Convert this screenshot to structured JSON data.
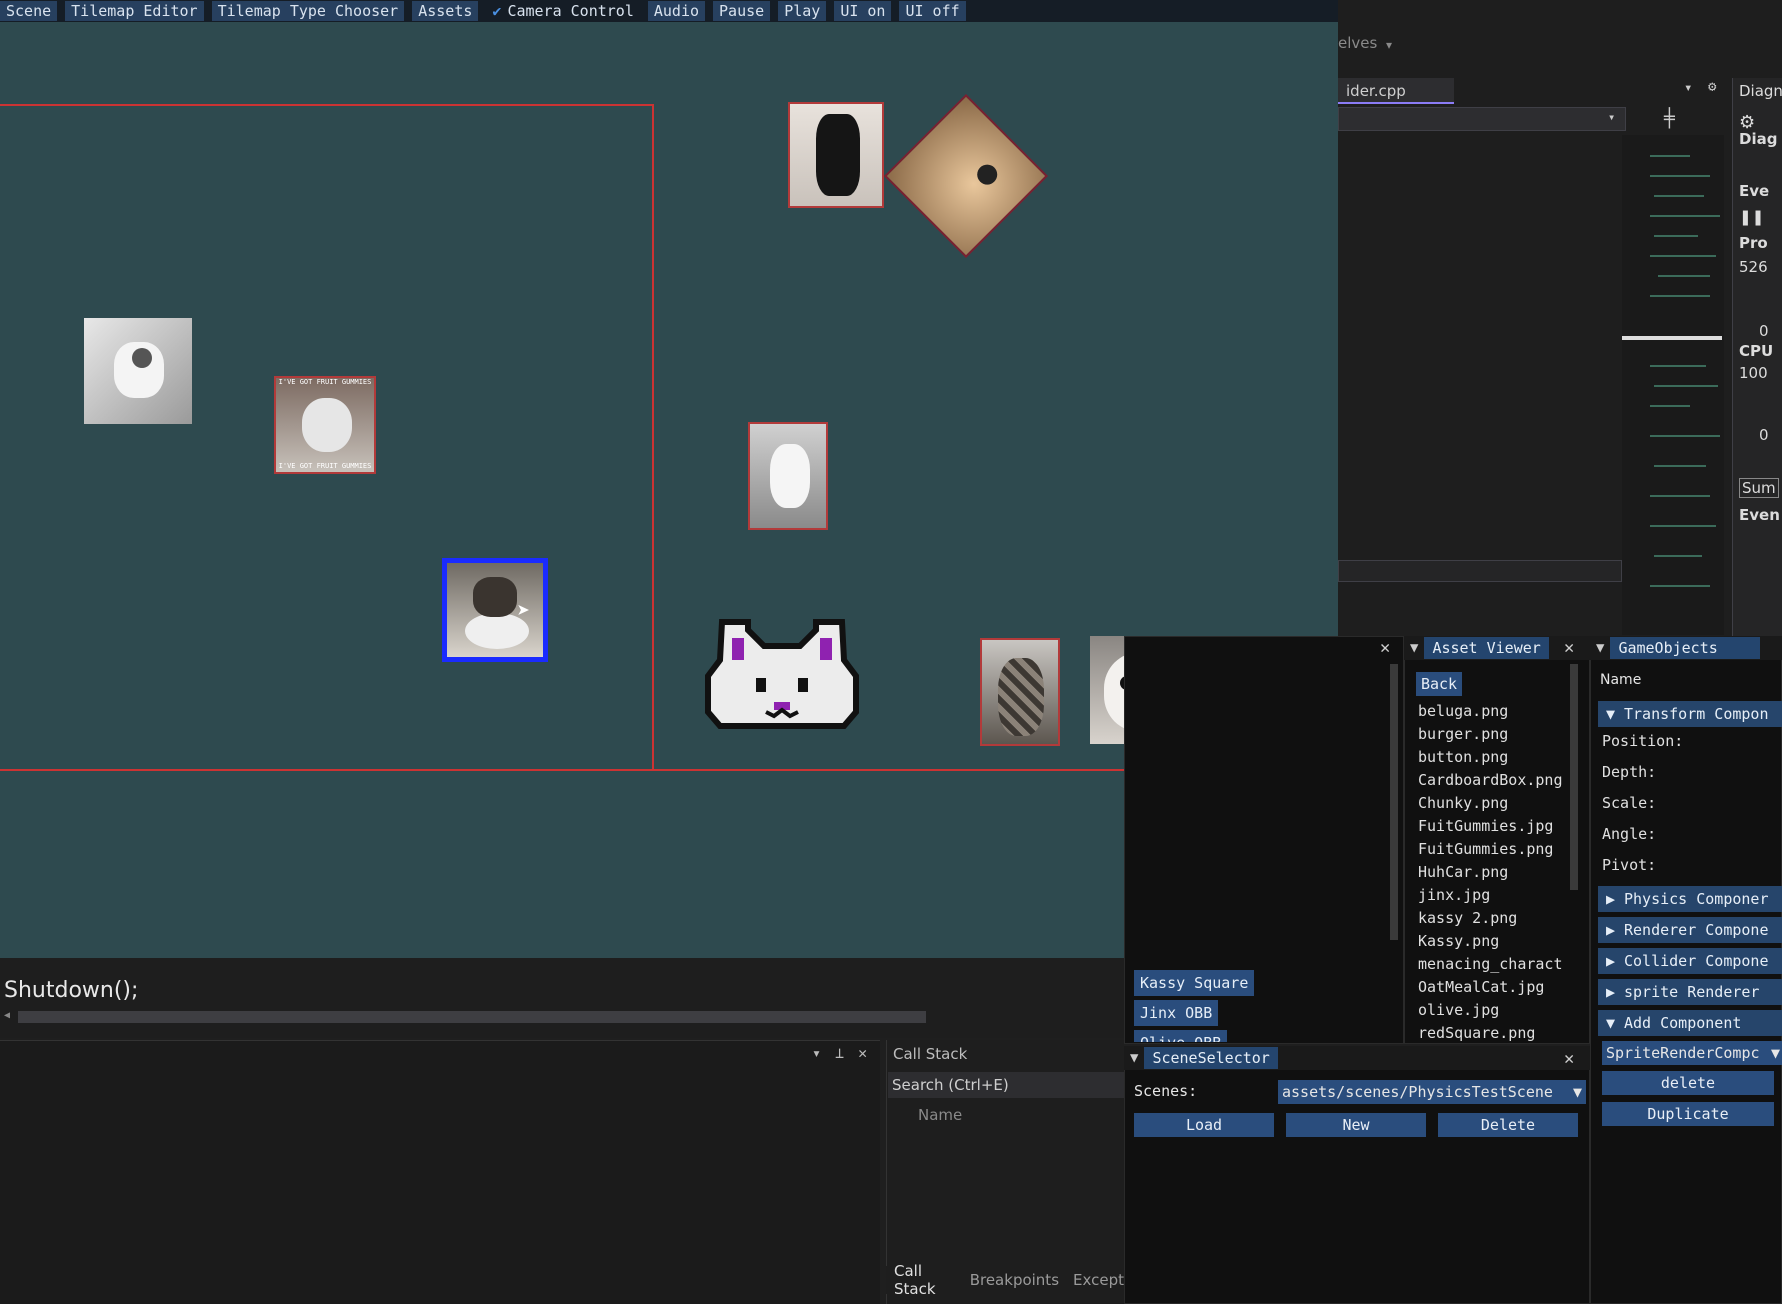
{
  "menubar": {
    "items": [
      "Scene",
      "Tilemap Editor",
      "Tilemap Type Chooser",
      "Assets",
      "Camera Control",
      "Audio",
      "Pause",
      "Play",
      "UI on",
      "UI off"
    ],
    "camera_control_checked": true
  },
  "vs": {
    "solution_label": "elves",
    "file_tab": "ider.cpp",
    "diag_title": "Diagn",
    "diag_sub": "Diag",
    "events": "Eve",
    "process": "Pro",
    "process_val": "526",
    "zero1": "0",
    "cpu": "CPU",
    "cpu_val": "100",
    "zero2": "0",
    "summary": "Sum",
    "event_tab": "Even",
    "output_line": "Shutdown();"
  },
  "callstack": {
    "title": "Call Stack",
    "search_placeholder": "Search (Ctrl+E)",
    "col_name": "Name",
    "tabs": [
      "Call Stack",
      "Breakpoints",
      "Except"
    ]
  },
  "asset_viewer": {
    "title": "Asset Viewer",
    "back_label": "Back",
    "files": [
      "beluga.png",
      "burger.png",
      "button.png",
      "CardboardBox.png",
      "Chunky.png",
      "FuitGummies.jpg",
      "FuitGummies.png",
      "HuhCar.png",
      "jinx.jpg",
      "kassy 2.png",
      "Kassy.png",
      "menacing_charact",
      "OatMealCat.jpg",
      "olive.jpg",
      "redSquare.png"
    ]
  },
  "gameobject_list": {
    "items": [
      "Kassy Square",
      "Jinx OBB",
      "Olive OBB"
    ]
  },
  "scene_selector": {
    "title": "SceneSelector",
    "scenes_label": "Scenes:",
    "scene_value": "assets/scenes/PhysicsTestScene",
    "load_label": "Load",
    "new_label": "New",
    "delete_label": "Delete"
  },
  "gameobjects": {
    "title": "GameObjects",
    "name_label": "Name",
    "transform_header": "Transform Compon",
    "props": [
      "Position:",
      "Depth:",
      "Scale:",
      "Angle:",
      "Pivot:"
    ],
    "components": [
      "Physics Componer",
      "Renderer Compone",
      "Collider Compone",
      "sprite Renderer"
    ],
    "add_component": "Add Component",
    "component_select": "SpriteRenderCompc",
    "delete_label": "delete",
    "duplicate_label": "Duplicate"
  },
  "sprites": {
    "meme_top_text": "I'VE GOT FRUIT GUMMIES",
    "meme_bottom_text": "I'VE GOT FRUIT GUMMIES"
  }
}
